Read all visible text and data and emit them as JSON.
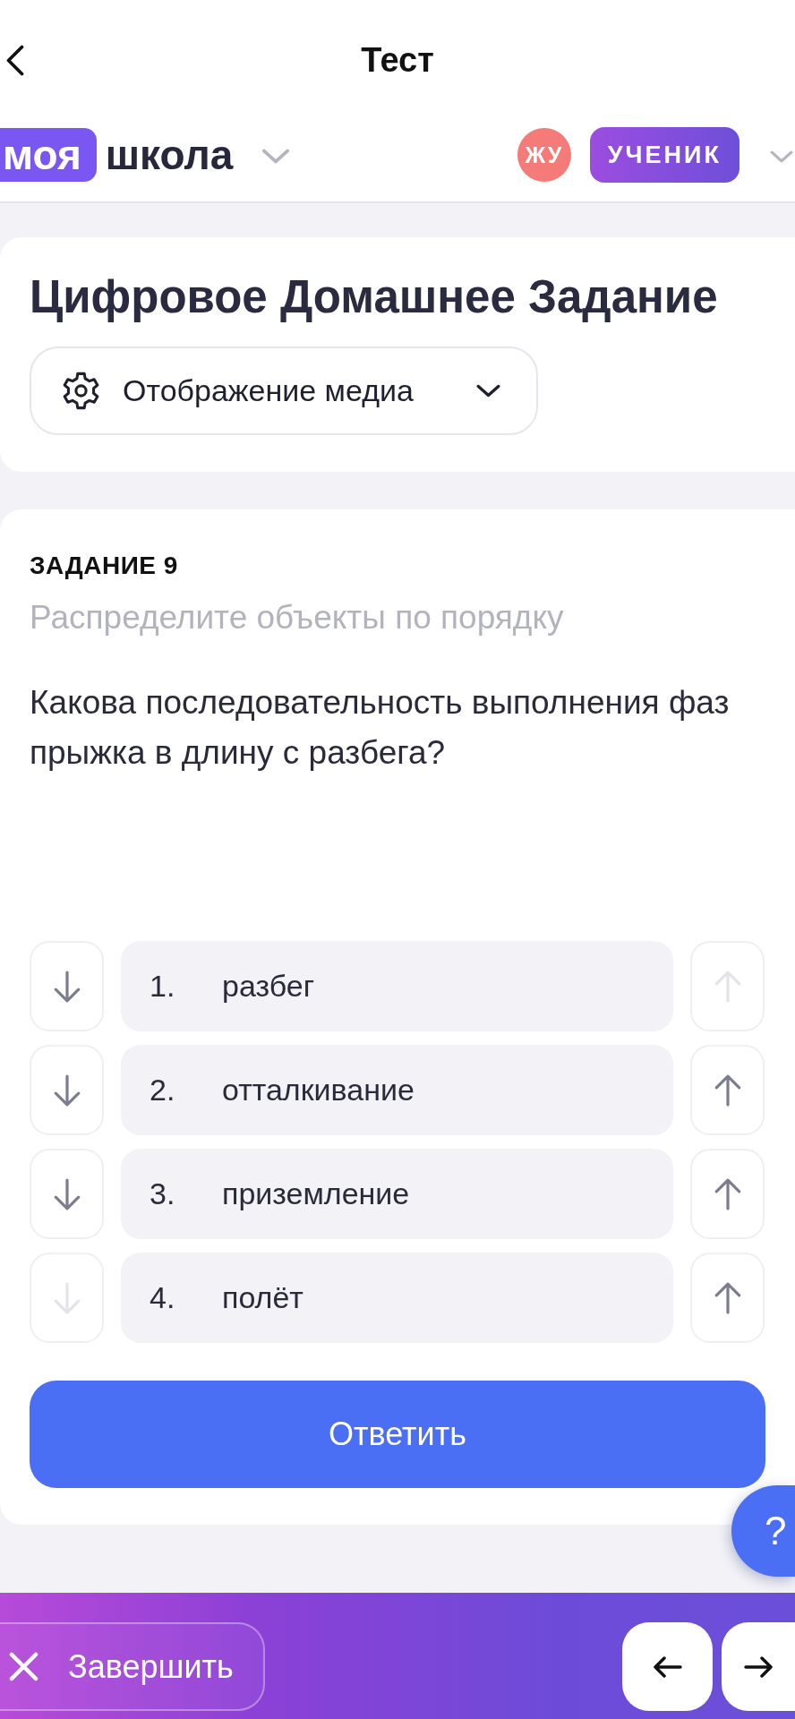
{
  "nav_bar": {
    "title": "Тест"
  },
  "header": {
    "logo_badge": "моя",
    "logo_text": "школа",
    "avatar_initials": "ЖУ",
    "role": "УЧЕНИК"
  },
  "homework_card": {
    "title": "Цифровое Домашнее Задание",
    "media_dropdown": "Отображение медиа"
  },
  "task": {
    "heading": "ЗАДАНИЕ 9",
    "instruction": "Распределите объекты по порядку",
    "question": "Какова последовательность выполнения фаз прыжка в длину с разбега?",
    "items": [
      {
        "number": "1.",
        "text": "разбег",
        "move_down_disabled": false,
        "move_up_disabled": true
      },
      {
        "number": "2.",
        "text": "отталкивание",
        "move_down_disabled": false,
        "move_up_disabled": false
      },
      {
        "number": "3.",
        "text": "приземление",
        "move_down_disabled": false,
        "move_up_disabled": false
      },
      {
        "number": "4.",
        "text": "полёт",
        "move_down_disabled": true,
        "move_up_disabled": false
      }
    ],
    "submit_button": "Ответить"
  },
  "help_button": "?",
  "footer": {
    "finish_button": "Завершить"
  }
}
